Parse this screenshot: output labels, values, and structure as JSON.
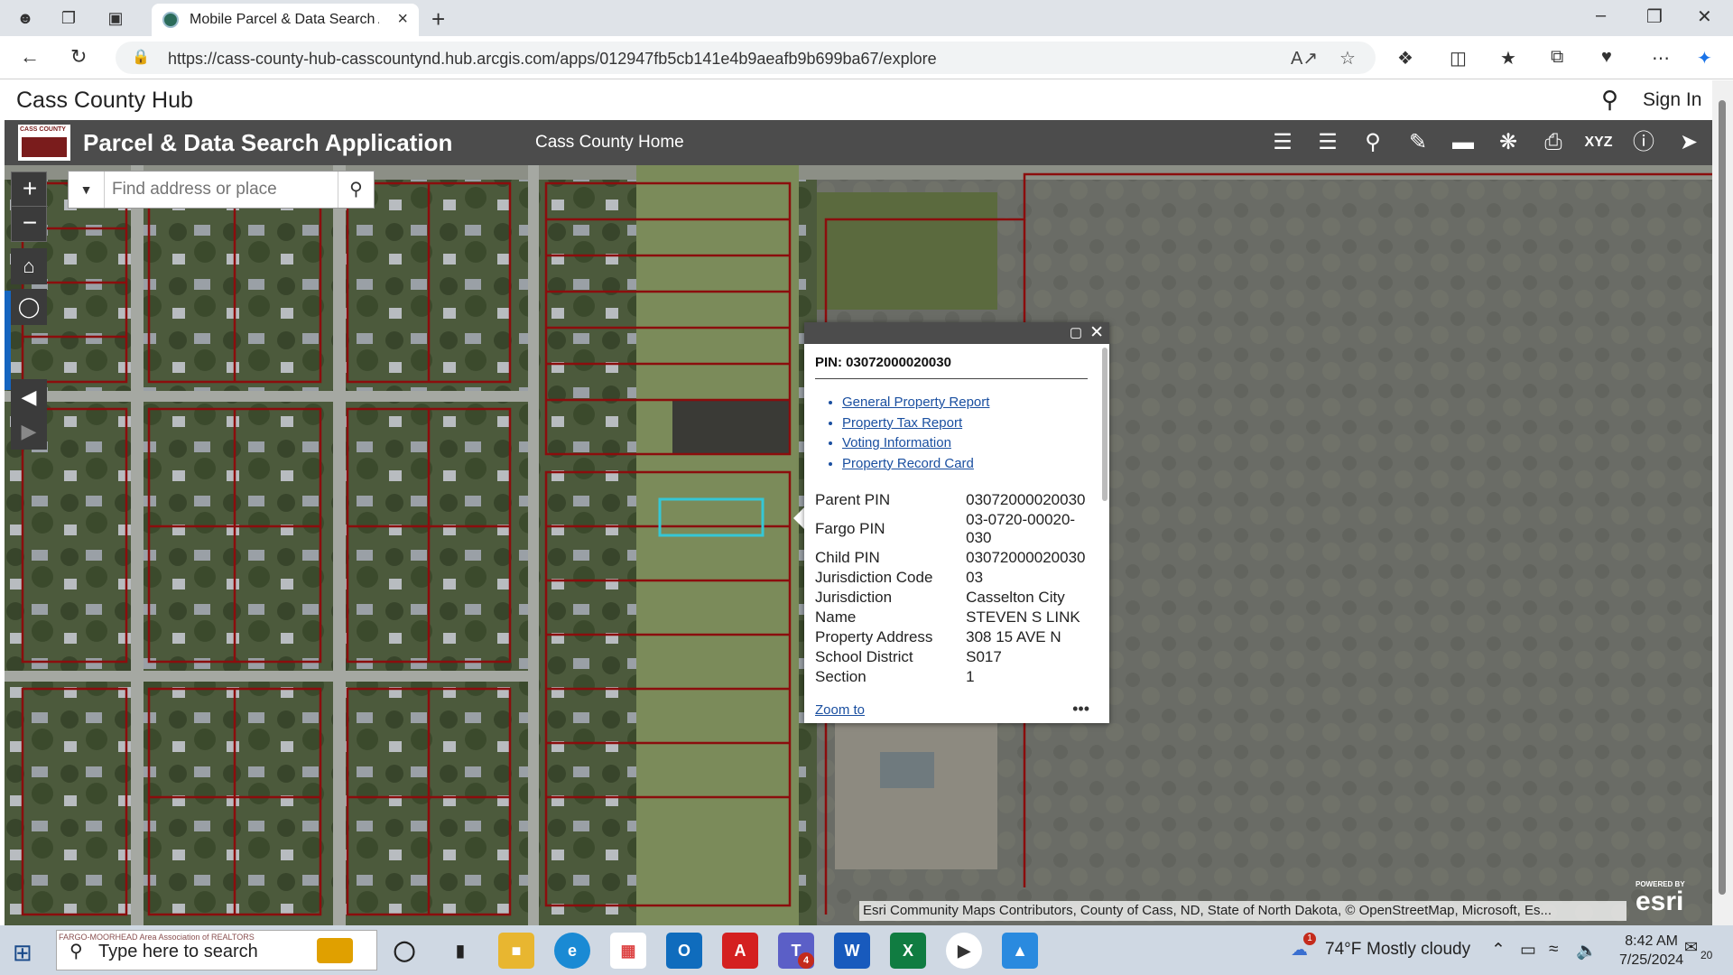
{
  "browser": {
    "tab_title": "Mobile Parcel & Data Search Application",
    "url": "https://cass-county-hub-casscountynd.hub.arcgis.com/apps/012947fb5cb141e4b9aeafb9b699ba67/explore"
  },
  "hub": {
    "title": "Cass County Hub",
    "sign_in": "Sign In"
  },
  "app": {
    "logo_text": "CASS COUNTY",
    "title": "Parcel & Data Search Application",
    "home_link": "Cass County Home",
    "tools": [
      "list-icon",
      "layers-icon",
      "query-icon",
      "draw-icon",
      "measure-icon",
      "analysis-icon",
      "print-icon",
      "coordinates-icon",
      "info-icon",
      "share-icon"
    ],
    "xyz_label": "XYZ"
  },
  "map": {
    "search_placeholder": "Find address or place",
    "attribution": "Esri Community Maps Contributors, County of Cass, ND, State of North Dakota, © OpenStreetMap, Microsoft, Es...",
    "powered_by": "POWERED BY",
    "esri_logo": "esri",
    "highlight_color": "#35c7d6",
    "parcel_color": "#8b0d0d"
  },
  "popup": {
    "title": "PIN: 03072000020030",
    "links": [
      "General Property Report",
      "Property Tax Report",
      "Voting Information",
      "Property Record Card"
    ],
    "fields": [
      {
        "label": "Parent PIN",
        "value": "03072000020030"
      },
      {
        "label": "Fargo PIN",
        "value": "03-0720-00020-030"
      },
      {
        "label": "Child PIN",
        "value": "03072000020030"
      },
      {
        "label": "Jurisdiction Code",
        "value": "03"
      },
      {
        "label": "Jurisdiction",
        "value": "Casselton City"
      },
      {
        "label": "Name",
        "value": "STEVEN S LINK"
      },
      {
        "label": "Property Address",
        "value": "308 15 AVE N"
      },
      {
        "label": "School District",
        "value": "S017"
      },
      {
        "label": "Section",
        "value": "1"
      }
    ],
    "zoom_to": "Zoom to",
    "more": "•••"
  },
  "taskbar": {
    "search_placeholder": "Type here to search",
    "search_watermark": "FARGO-MOORHEAD Area Association of REALTORS",
    "weather_temp": "74°F",
    "weather_desc": "Mostly cloudy",
    "weather_badge": "1",
    "time": "8:42 AM",
    "date": "7/25/2024",
    "notifications": "20",
    "teams_badge": "4"
  }
}
